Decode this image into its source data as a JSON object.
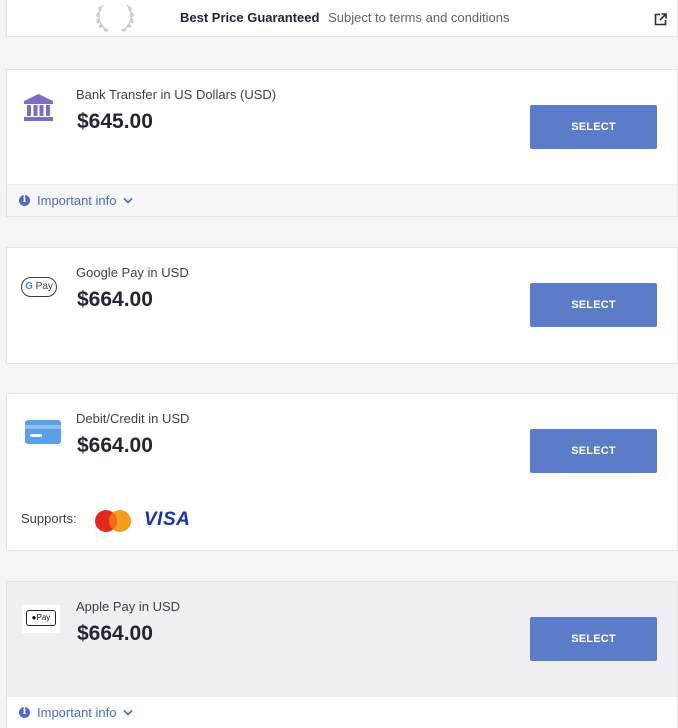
{
  "banner": {
    "title": "Best Price Guaranteed",
    "subtitle": "Subject to terms and conditions",
    "icons": [
      "laurel-wreath-icon",
      "external-link-icon"
    ]
  },
  "payment_options": [
    {
      "method": "Bank Transfer in US Dollars (USD)",
      "price": "$645.00",
      "icon": "bank-icon",
      "button": "SELECT",
      "info": "Important info"
    },
    {
      "method": "Google Pay in USD",
      "price": "$664.00",
      "icon": "google-pay-icon",
      "icon_text": "Pay",
      "icon_letter": "G",
      "button": "SELECT"
    },
    {
      "method": "Debit/Credit in USD",
      "price": "$664.00",
      "icon": "credit-card-icon",
      "button": "SELECT",
      "supports_label": "Supports:",
      "supports_brands": [
        "mastercard-icon",
        "VISA"
      ]
    },
    {
      "method": "Apple Pay in USD",
      "price": "$664.00",
      "icon": "apple-pay-icon",
      "icon_text": "Pay",
      "button": "SELECT",
      "info": "Important info",
      "highlighted": true
    }
  ],
  "colors": {
    "button": "#5b7cc6",
    "link": "#4b6cc4",
    "bank_icon": "#7c6cc6",
    "card_icon": "#5aa0e8",
    "visa": "#1a33a8"
  }
}
